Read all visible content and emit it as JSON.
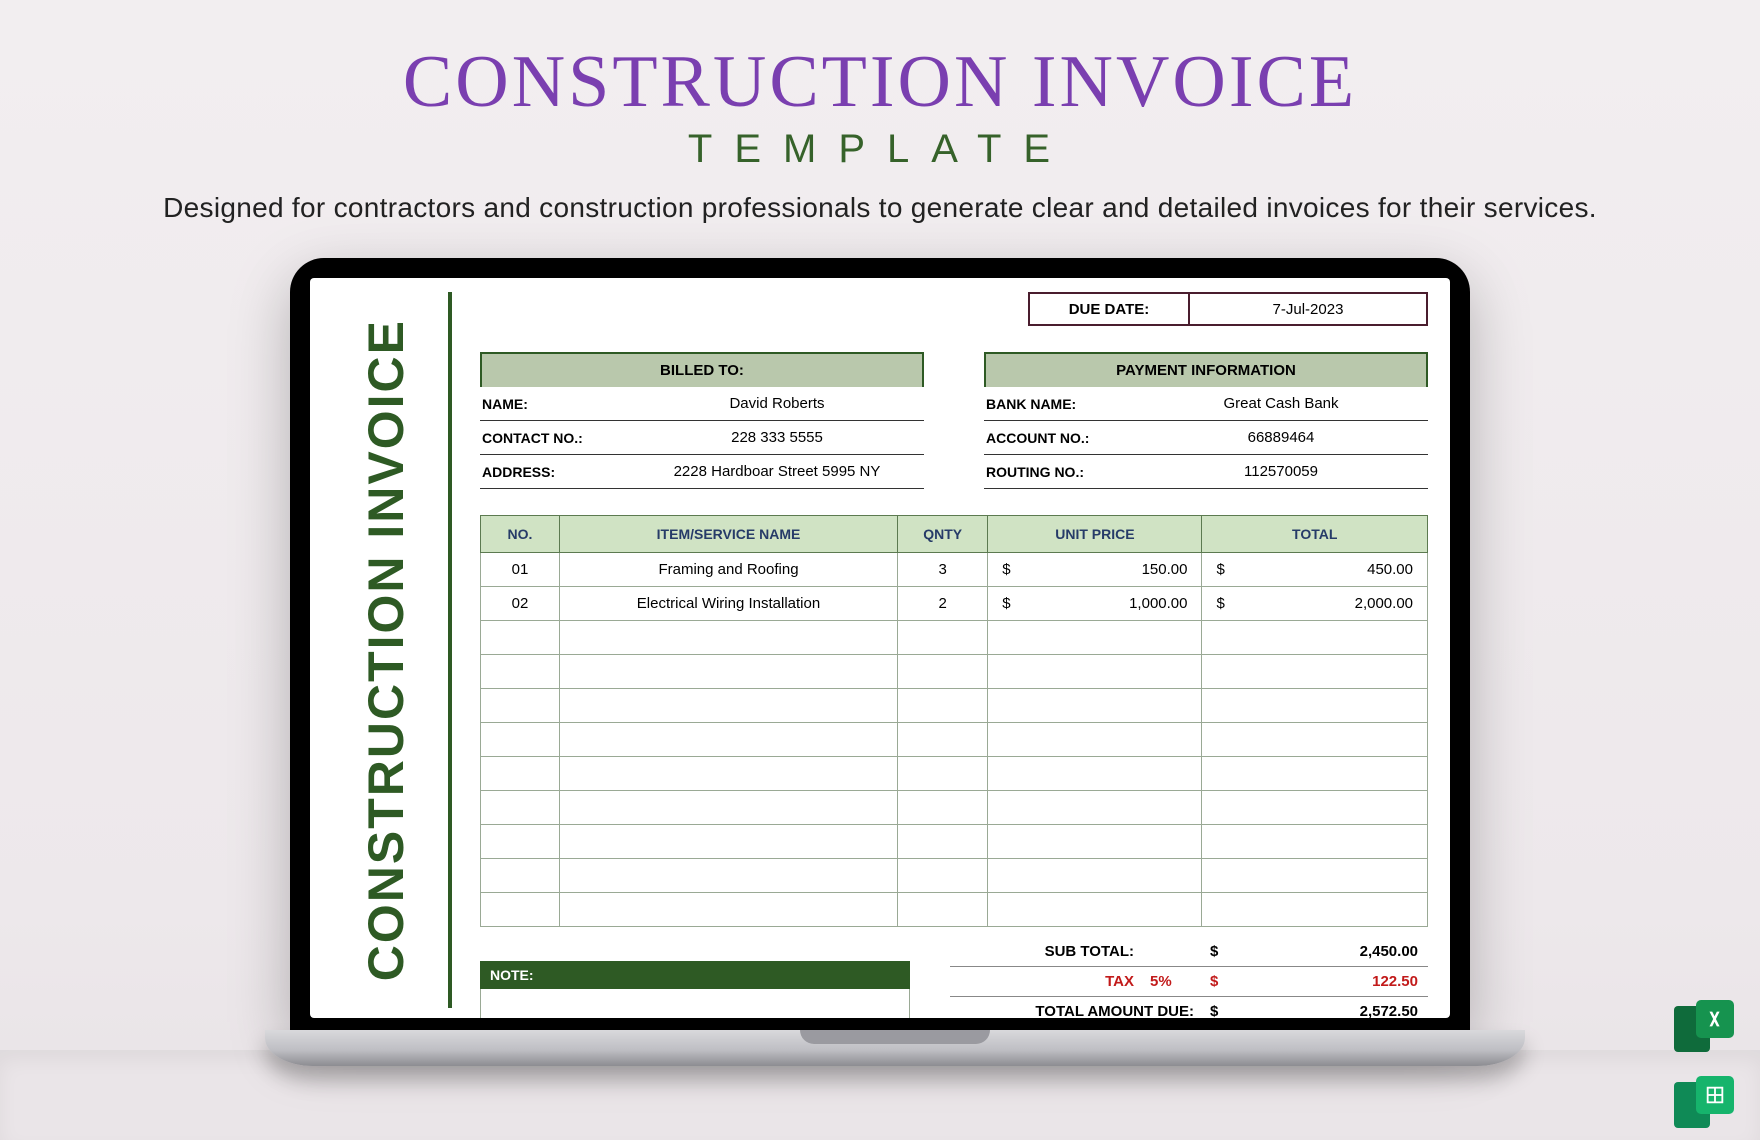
{
  "header": {
    "title": "CONSTRUCTION INVOICE",
    "subtitle": "TEMPLATE",
    "description": "Designed for contractors and construction professionals to generate clear and detailed invoices for their services."
  },
  "invoice": {
    "side_label": "CONSTRUCTION INVOICE",
    "due_date_label": "DUE DATE:",
    "due_date_value": "7-Jul-2023",
    "billed_to_header": "BILLED TO:",
    "billed_to": {
      "name_label": "NAME:",
      "name_value": "David Roberts",
      "contact_label": "CONTACT NO.:",
      "contact_value": "228 333 5555",
      "address_label": "ADDRESS:",
      "address_value": "2228 Hardboar Street 5995 NY"
    },
    "payment_header": "PAYMENT INFORMATION",
    "payment": {
      "bank_label": "BANK NAME:",
      "bank_value": "Great Cash Bank",
      "account_label": "ACCOUNT NO.:",
      "account_value": "66889464",
      "routing_label": "ROUTING NO.:",
      "routing_value": "112570059"
    },
    "columns": {
      "no": "NO.",
      "name": "ITEM/SERVICE NAME",
      "qty": "QNTY",
      "unit": "UNIT PRICE",
      "total": "TOTAL"
    },
    "items": [
      {
        "no": "01",
        "name": "Framing and Roofing",
        "qty": "3",
        "unit": "150.00",
        "total": "450.00"
      },
      {
        "no": "02",
        "name": "Electrical Wiring Installation",
        "qty": "2",
        "unit": "1,000.00",
        "total": "2,000.00"
      }
    ],
    "currency": "$",
    "note_label": "NOTE:",
    "totals": {
      "subtotal_label": "SUB TOTAL:",
      "subtotal_value": "2,450.00",
      "tax_label": "TAX",
      "tax_pct": "5%",
      "tax_value": "122.50",
      "due_label": "TOTAL AMOUNT DUE:",
      "due_value": "2,572.50"
    }
  },
  "formats": {
    "excel": "excel-icon",
    "sheets": "google-sheets-icon"
  }
}
